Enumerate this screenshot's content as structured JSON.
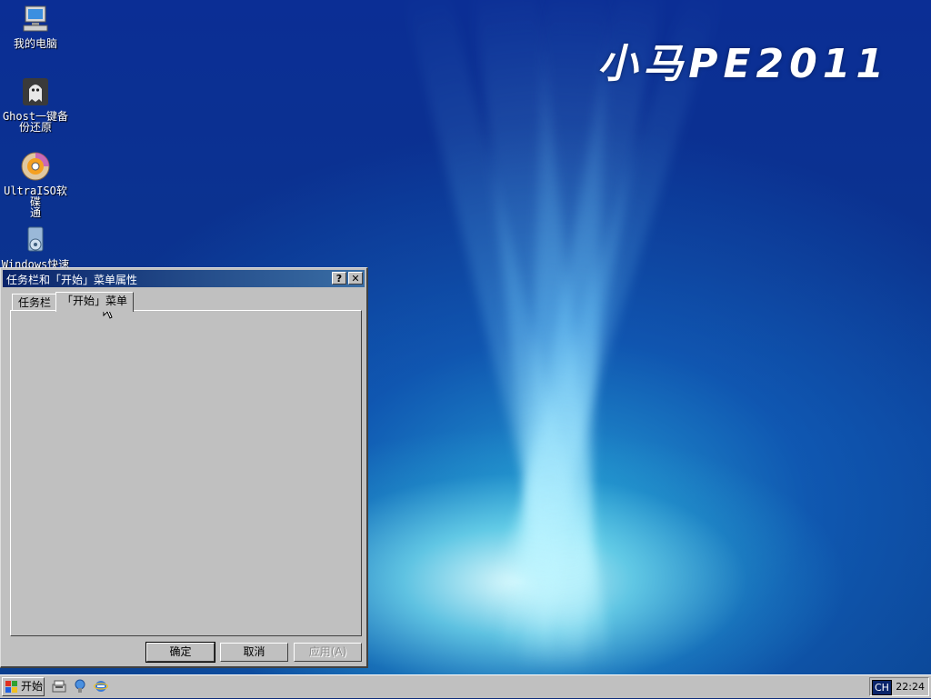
{
  "desktop": {
    "brand_text": "小马PE2011",
    "icons": [
      {
        "label_line1": "我的电脑",
        "label_line2": "",
        "icon": "my-computer-icon"
      },
      {
        "label_line1": "Ghost一键备",
        "label_line2": "份还原",
        "icon": "ghost-backup-icon"
      },
      {
        "label_line1": "UltraISO软碟",
        "label_line2": "通",
        "icon": "ultraiso-disc-icon"
      },
      {
        "label_line1": "Windows快速",
        "label_line2": "",
        "icon": "windows-quick-icon"
      }
    ]
  },
  "dialog": {
    "title": "任务栏和「开始」菜单属性",
    "help_button": "?",
    "close_button": "✕",
    "tabs": [
      {
        "label": "任务栏",
        "selected": false
      },
      {
        "label": "「开始」菜单",
        "selected": true
      }
    ],
    "buttons": {
      "ok": "确定",
      "cancel": "取消",
      "apply": "应用(A)"
    }
  },
  "taskbar": {
    "start_label": "开始",
    "quick_launch": [
      "desktop-shortcut-icon",
      "network-icon",
      "ie-icon"
    ],
    "input_indicator": "CH",
    "clock": "22:24"
  },
  "colors": {
    "title_bar": "#0a246a",
    "window_face": "#c0c0c0",
    "desktop_blue": "#0b2e95",
    "desktop_glow": "#bff4ff"
  }
}
